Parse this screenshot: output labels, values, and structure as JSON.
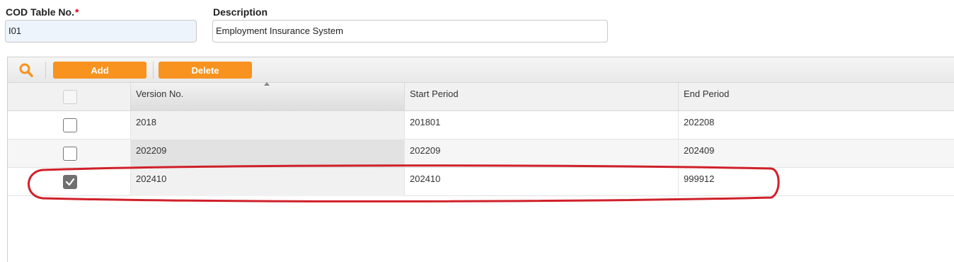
{
  "form": {
    "table_no_label": "COD Table No.",
    "required_mark": "*",
    "table_no_value": "I01",
    "description_label": "Description",
    "description_value": "Employment Insurance System"
  },
  "toolbar": {
    "search_icon": "search-icon",
    "add_label": "Add",
    "delete_label": "Delete",
    "accent_color": "#f7931e"
  },
  "grid": {
    "columns": [
      "Version No.",
      "Start Period",
      "End Period"
    ],
    "sorted_column": "Version No.",
    "rows": [
      {
        "checked": false,
        "version": "2018",
        "start": "201801",
        "end": "202208"
      },
      {
        "checked": false,
        "version": "202209",
        "start": "202209",
        "end": "202409"
      },
      {
        "checked": true,
        "version": "202410",
        "start": "202410",
        "end": "999912"
      }
    ],
    "highlight_color": "#d0202a"
  }
}
